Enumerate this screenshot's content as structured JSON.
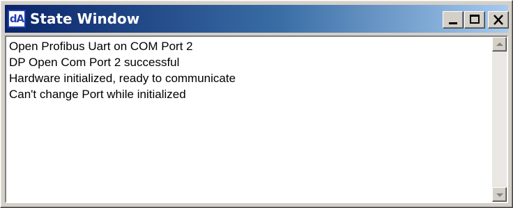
{
  "window": {
    "title": "State Window",
    "app_icon_text": "dA"
  },
  "log": {
    "lines": [
      "Open Profibus Uart on COM Port 2",
      "DP Open Com Port 2 successful",
      "Hardware initialized, ready to communicate",
      "Can't change Port while initialized"
    ]
  },
  "colors": {
    "titlebar_start": "#0a246a",
    "titlebar_end": "#a6caf0",
    "face": "#d4d0c8"
  },
  "icons": [
    "app-icon",
    "minimize-icon",
    "maximize-icon",
    "close-icon",
    "scroll-up-arrow-icon",
    "scroll-down-arrow-icon"
  ]
}
